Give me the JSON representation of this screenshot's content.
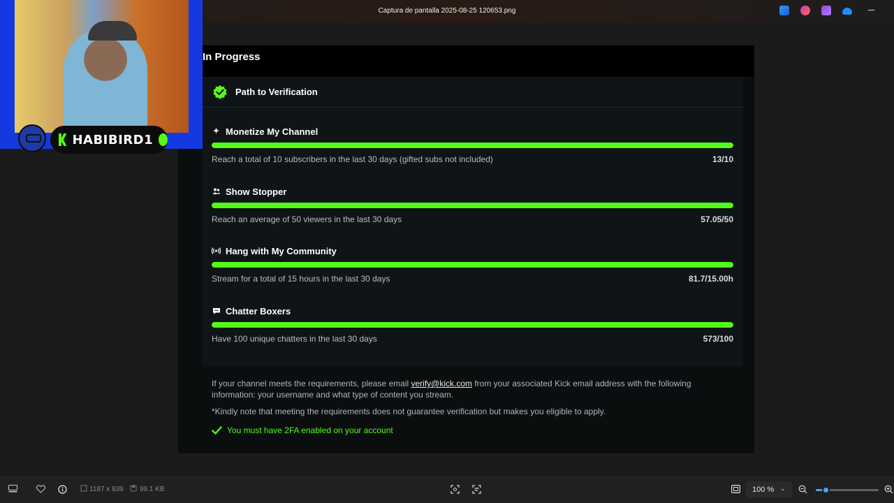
{
  "window": {
    "title": "Captura de pantalla 2025-08-25 120653.png",
    "app_icons": [
      "clipchamp-icon",
      "copilot-icon",
      "onenote-icon",
      "onedrive-icon"
    ]
  },
  "kick": {
    "header": "In Progress",
    "card_title": "Path to Verification",
    "tasks": [
      {
        "icon": "sparkle-icon",
        "name": "Monetize My Channel",
        "desc": "Reach a total of 10 subscribers in the last 30 days (gifted subs not included)",
        "value": "13/10",
        "progress": 1.0
      },
      {
        "icon": "users-icon",
        "name": "Show Stopper",
        "desc": "Reach an average of 50 viewers in the last 30 days",
        "value": "57.05/50",
        "progress": 1.0
      },
      {
        "icon": "broadcast-icon",
        "name": "Hang with My Community",
        "desc": "Stream for a total of 15 hours in the last 30 days",
        "value": "81.7/15.00h",
        "progress": 1.0
      },
      {
        "icon": "chat-icon",
        "name": "Chatter Boxers",
        "desc": "Have 100 unique chatters in the last 30 days",
        "value": "573/100",
        "progress": 1.0
      }
    ],
    "info_prefix": "If your channel meets the requirements, please email ",
    "info_email": "verify@kick.com",
    "info_suffix": " from your associated Kick email address with the following information: your username and what type of content you stream.",
    "note": "*Kindly note that meeting the requirements does not guarantee verification but makes you eligible to apply.",
    "twofa": "You must have 2FA enabled on your account",
    "accent": "#53fc18"
  },
  "webcam": {
    "username": "HABIBIRD1"
  },
  "statusbar": {
    "dimensions": "1187 x 839",
    "filesize": "99.1 KB",
    "zoom": "100 %",
    "zoom_level": 0.15
  }
}
